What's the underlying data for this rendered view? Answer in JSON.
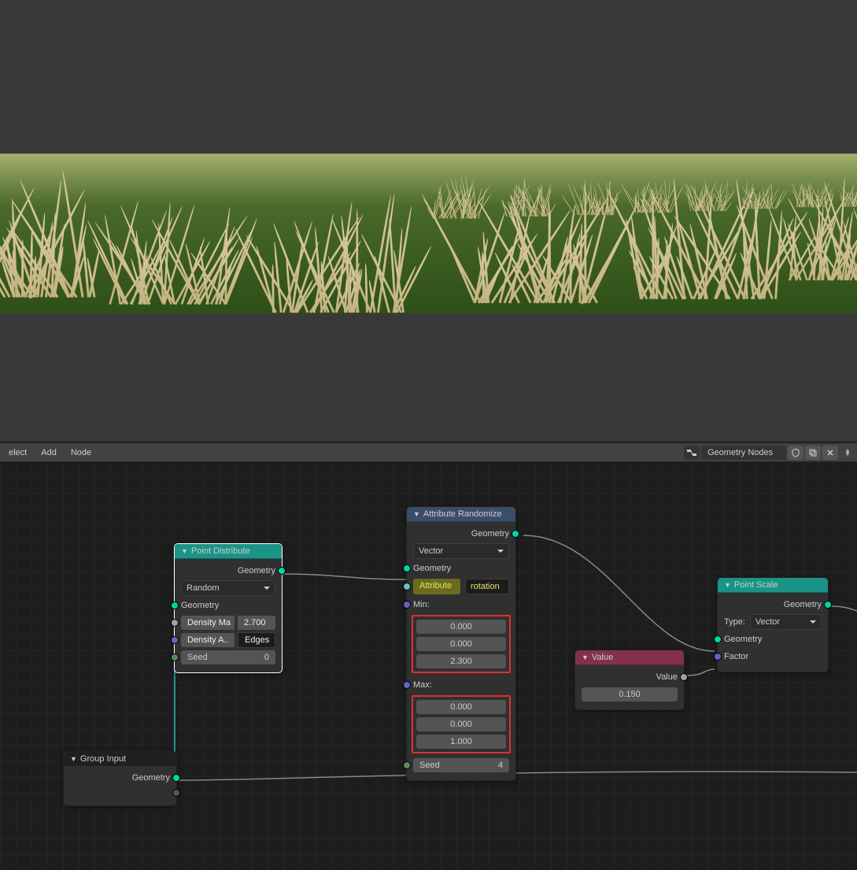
{
  "header": {
    "menus": [
      "elect",
      "Add",
      "Node"
    ],
    "editor_type": "Geometry Nodes",
    "pin": true
  },
  "nodes": {
    "group_input": {
      "title": "Group Input",
      "output_geometry": "Geometry"
    },
    "point_distribute": {
      "title": "Point Distribute",
      "output_geometry": "Geometry",
      "mode": "Random",
      "input_geometry": "Geometry",
      "density_max_label": "Density Ma",
      "density_max_value": "2.700",
      "density_attr_label": "Density A..",
      "density_attr_value": "Edges",
      "seed_label": "Seed",
      "seed_value": "0"
    },
    "attribute_randomize": {
      "title": "Attribute Randomize",
      "output_geometry": "Geometry",
      "type": "Vector",
      "input_geometry": "Geometry",
      "attribute_label": "Attribute",
      "attribute_value": "rotation",
      "min_label": "Min:",
      "min_x": "0.000",
      "min_y": "0.000",
      "min_z": "2.300",
      "max_label": "Max:",
      "max_x": "0.000",
      "max_y": "0.000",
      "max_z": "1.000",
      "seed_label": "Seed",
      "seed_value": "4"
    },
    "value": {
      "title": "Value",
      "output_label": "Value",
      "value": "0.150"
    },
    "point_scale": {
      "title": "Point Scale",
      "output_geometry": "Geometry",
      "type_label": "Type:",
      "type_value": "Vector",
      "input_geometry": "Geometry",
      "factor_label": "Factor"
    }
  }
}
